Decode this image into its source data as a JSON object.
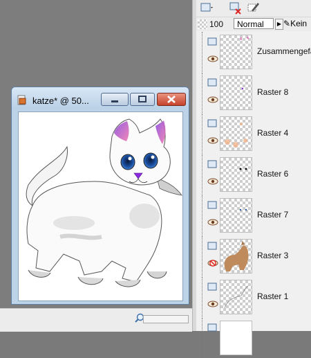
{
  "document_window": {
    "title": "katze* @  50...",
    "minimize_icon": "minimize-icon",
    "maximize_icon": "maximize-icon",
    "close_icon": "close-icon"
  },
  "toolbar": {
    "icons": [
      "new-layer-icon",
      "delete-layer-icon",
      "edit-layer-icon"
    ]
  },
  "layer_options": {
    "opacity": "100",
    "blend_mode": "Normal",
    "lock_label": "Kein"
  },
  "layers": [
    {
      "name": "Zusammengefasst",
      "visible": true
    },
    {
      "name": "Raster 8",
      "visible": true
    },
    {
      "name": "Raster 4",
      "visible": true
    },
    {
      "name": "Raster 6",
      "visible": true
    },
    {
      "name": "Raster 7",
      "visible": true
    },
    {
      "name": "Raster 3",
      "visible": false
    },
    {
      "name": "Raster 1",
      "visible": true
    }
  ],
  "colors": {
    "window_frame": "#bcd3e8",
    "close_button": "#c8472e",
    "eye_blue": "#2a5aa8",
    "ear_pink": "#e06ab0",
    "nose_purple": "#8a2be2"
  }
}
